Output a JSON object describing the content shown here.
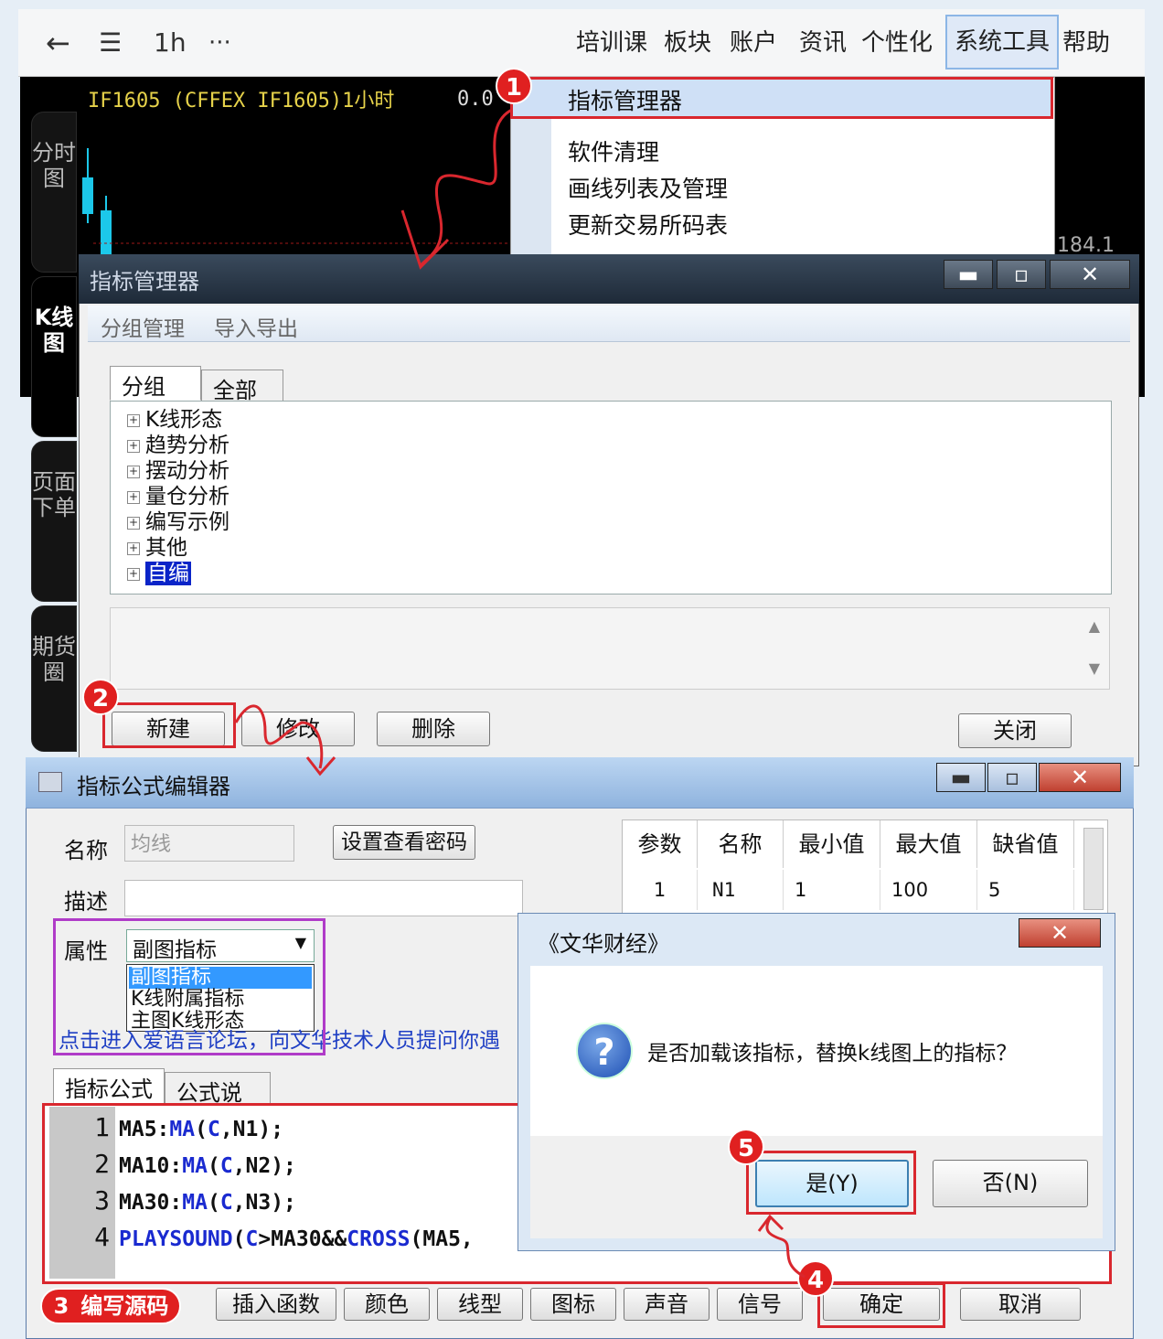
{
  "toolbar": {
    "back": "←",
    "list": "☰",
    "period": "1h",
    "more": "···",
    "menus": [
      "培训课",
      "板块",
      "账户",
      "资讯",
      "个性化",
      "系统工具",
      "帮助"
    ]
  },
  "chart": {
    "title": "IF1605  (CFFEX IF1605)1小时",
    "value": "0.0",
    "price": "184.1",
    "side_tabs": [
      "分时图",
      "K线图",
      "页面下单",
      "期货圈"
    ]
  },
  "dropdown": {
    "items": [
      "指标管理器",
      "软件清理",
      "画线列表及管理",
      "更新交易所码表"
    ]
  },
  "badges": {
    "b1": "1",
    "b2": "2",
    "b3": "3",
    "b4": "4",
    "b5": "5"
  },
  "manager": {
    "title": "指标管理器",
    "menu": [
      "分组管理",
      "导入导出"
    ],
    "tabs": [
      "分组",
      "全部"
    ],
    "tree": [
      "K线形态",
      "趋势分析",
      "摆动分析",
      "量仓分析",
      "编写示例",
      "其他",
      "自编"
    ],
    "buttons": {
      "new": "新建",
      "modify": "修改",
      "delete": "删除",
      "close": "关闭"
    }
  },
  "editor": {
    "title": "指标公式编辑器",
    "name_label": "名称",
    "name_value": "均线",
    "password_btn": "设置查看密码",
    "desc_label": "描述",
    "attr_label": "属性",
    "attr_value": "副图指标",
    "attr_options": [
      "副图指标",
      "K线附属指标",
      "主图K线形态"
    ],
    "link_text": "点击进入爱语言论坛，向文华技术人员提问你遇",
    "param_headers": [
      "参数",
      "名称",
      "最小值",
      "最大值",
      "缺省值"
    ],
    "param_row": [
      "1",
      "N1",
      "1",
      "100",
      "5"
    ],
    "code_tabs": [
      "指标公式",
      "公式说明"
    ],
    "code_numbers": [
      "1",
      "2",
      "3",
      "4"
    ],
    "bottom_label": "编写源码",
    "bottom_buttons": [
      "插入函数",
      "颜色",
      "线型",
      "图标",
      "声音",
      "信号",
      "确定",
      "取消"
    ]
  },
  "dialog": {
    "title": "《文华财经》",
    "message": "是否加载该指标，替换k线图上的指标？",
    "yes": "是(Y)",
    "no": "否(N)"
  },
  "colors": {
    "annotation_red": "#d9272e",
    "badge_red": "#e02020",
    "keyword_blue": "#1a2ad0",
    "attr_box_purple": "#b03cc8"
  }
}
